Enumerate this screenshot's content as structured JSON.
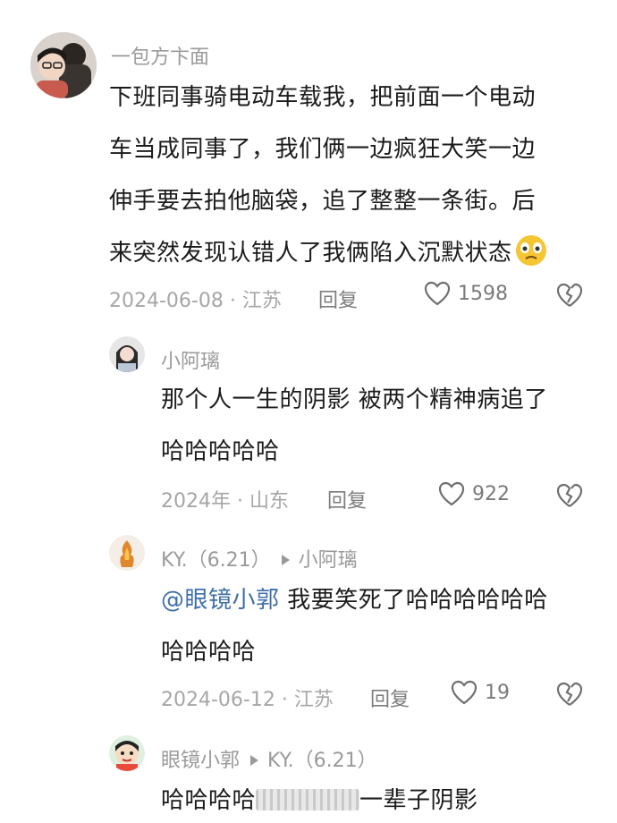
{
  "comments": [
    {
      "author": "一包方卞面",
      "lines": [
        "下班同事骑电动车载我，把前面一个电动",
        "车当成同事了，我们俩一边疯狂大笑一边",
        "伸手要去拍他脑袋，追了整整一条街。后",
        "来突然发现认错人了我俩陷入沉默状态"
      ],
      "emoji_icon": "worried-face-emoji",
      "date_location": "2024-06-08 · 江苏",
      "reply_label": "回复",
      "likes": "1598"
    },
    {
      "author": "小阿璃",
      "lines": [
        "那个人一生的阴影 被两个精神病追了",
        "哈哈哈哈哈"
      ],
      "date_location": "2024年 · 山东",
      "reply_label": "回复",
      "likes": "922"
    },
    {
      "author": "KY.（6.21）",
      "reply_to": "小阿璃",
      "mention": "@眼镜小郭",
      "lines": [
        "我要笑死了哈哈哈哈哈哈",
        "哈哈哈哈"
      ],
      "date_location": "2024-06-12 · 江苏",
      "reply_label": "回复",
      "likes": "19"
    },
    {
      "author": "眼镜小郭",
      "reply_to": "KY.（6.21）",
      "line_start": "哈哈哈哈",
      "line_end": "一辈子阴影"
    }
  ],
  "colors": {
    "mention": "#3e6fa8",
    "meta": "#a6a6a6",
    "name": "#9a9a9a"
  }
}
